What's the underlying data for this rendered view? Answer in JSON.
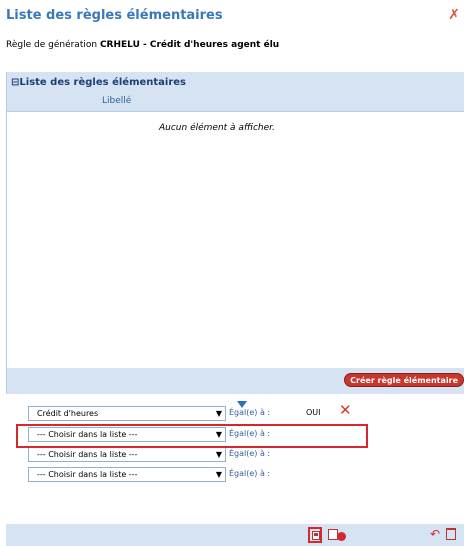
{
  "window": {
    "title": "Liste des règles élémentaires",
    "subtitle_prefix": "Règle de génération",
    "subtitle_code": "CRHELU - Crédit d'heures agent élu"
  },
  "panel": {
    "title": "Liste des règles élémentaires",
    "column_header": "Libellé",
    "empty_message": "Aucun élément à afficher.",
    "create_button": "Créer règle élémentaire"
  },
  "filters": {
    "rows": [
      {
        "select": "Crédit d'heures",
        "operator": "Égal(e) à :",
        "value": "OUI"
      },
      {
        "select": "--- Choisir dans la liste ---",
        "operator": "Égal(e) à :",
        "value": ""
      },
      {
        "select": "--- Choisir dans la liste ---",
        "operator": "Égal(e) à :",
        "value": ""
      },
      {
        "select": "--- Choisir dans la liste ---",
        "operator": "Égal(e) à :",
        "value": ""
      }
    ]
  },
  "icons": {
    "close": "close-icon",
    "delete": "delete-x-icon",
    "save": "save-icon",
    "save_new": "save-new-icon",
    "undo": "undo-icon",
    "trash": "trash-icon"
  },
  "colors": {
    "title": "#3a78b9",
    "header_bg": "#d5e3f3",
    "accent_red": "#d7262e"
  }
}
